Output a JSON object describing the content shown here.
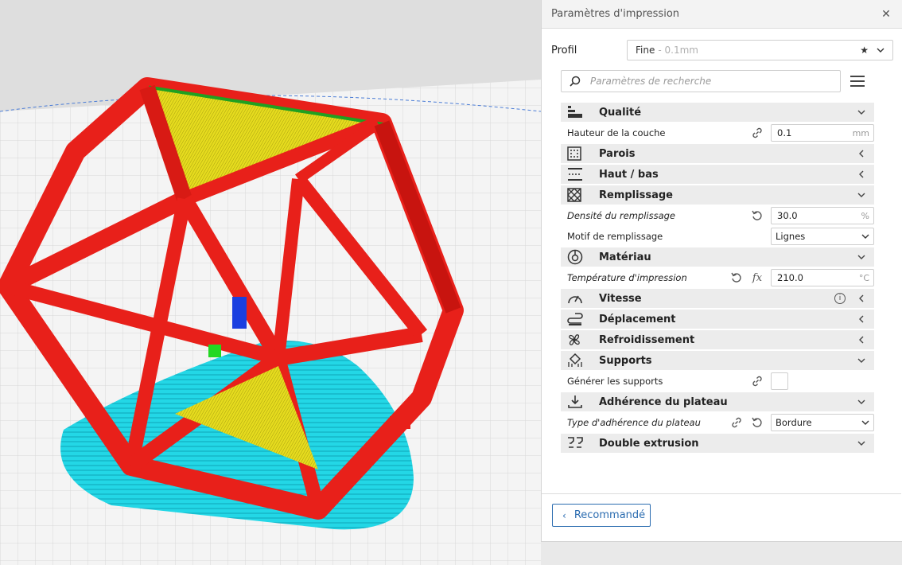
{
  "panel": {
    "title": "Paramètres d'impression",
    "close_icon": "close-icon"
  },
  "profile": {
    "label": "Profil",
    "name": "Fine",
    "sub": "- 0.1mm"
  },
  "search": {
    "placeholder": "Paramètres de recherche"
  },
  "categories": {
    "qualite": "Qualité",
    "parois": "Parois",
    "haut_bas": "Haut / bas",
    "remplissage": "Remplissage",
    "materiau": "Matériau",
    "vitesse": "Vitesse",
    "deplacement": "Déplacement",
    "refroidissement": "Refroidissement",
    "supports": "Supports",
    "adherence": "Adhérence du plateau",
    "double": "Double extrusion"
  },
  "settings": {
    "layer_height": {
      "label": "Hauteur de la couche",
      "value": "0.1",
      "unit": "mm"
    },
    "infill_density": {
      "label": "Densité du remplissage",
      "value": "30.0",
      "unit": "%"
    },
    "infill_pattern": {
      "label": "Motif de remplissage",
      "value": "Lignes"
    },
    "print_temp": {
      "label": "Température d'impression",
      "value": "210.0",
      "unit": "°C"
    },
    "gen_supports": {
      "label": "Générer les supports",
      "checked": false
    },
    "adhesion_type": {
      "label": "Type d'adhérence du plateau",
      "value": "Bordure"
    }
  },
  "footer": {
    "recommended": "Recommandé"
  },
  "colors": {
    "accent": "#2b6cb0",
    "model_red": "#e8201a",
    "skirt_cyan": "#24d8e6",
    "top_yellow": "#e8e020"
  }
}
